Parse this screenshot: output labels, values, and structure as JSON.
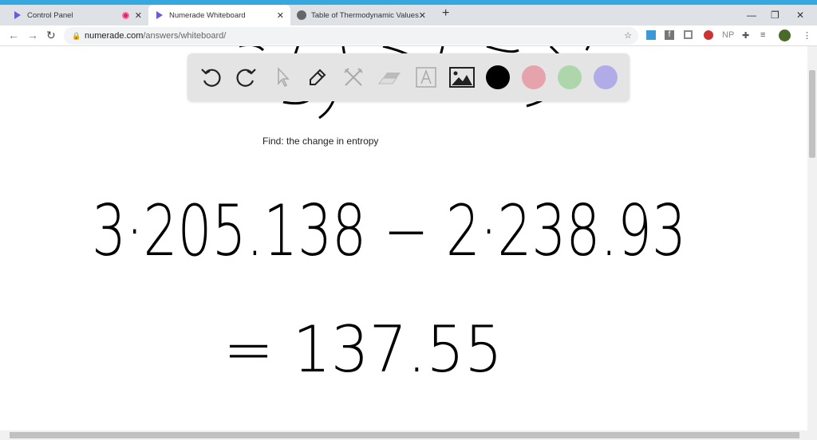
{
  "browser": {
    "tabs": [
      {
        "label": "Control Panel"
      },
      {
        "label": "Numerade Whiteboard"
      },
      {
        "label": "Table of Thermodynamic Values"
      }
    ],
    "url_host": "numerade.com",
    "url_path": "/answers/whiteboard/",
    "extension_np": "NP"
  },
  "toolbar": {
    "colors": [
      "#000000",
      "#e6a3ab",
      "#add6aa",
      "#b1abe8"
    ]
  },
  "canvas": {
    "prompt": "Find: the change in entropy",
    "handwriting_line1": "3·205.138 − 2·238.93",
    "handwriting_line2": "= 137.55"
  }
}
